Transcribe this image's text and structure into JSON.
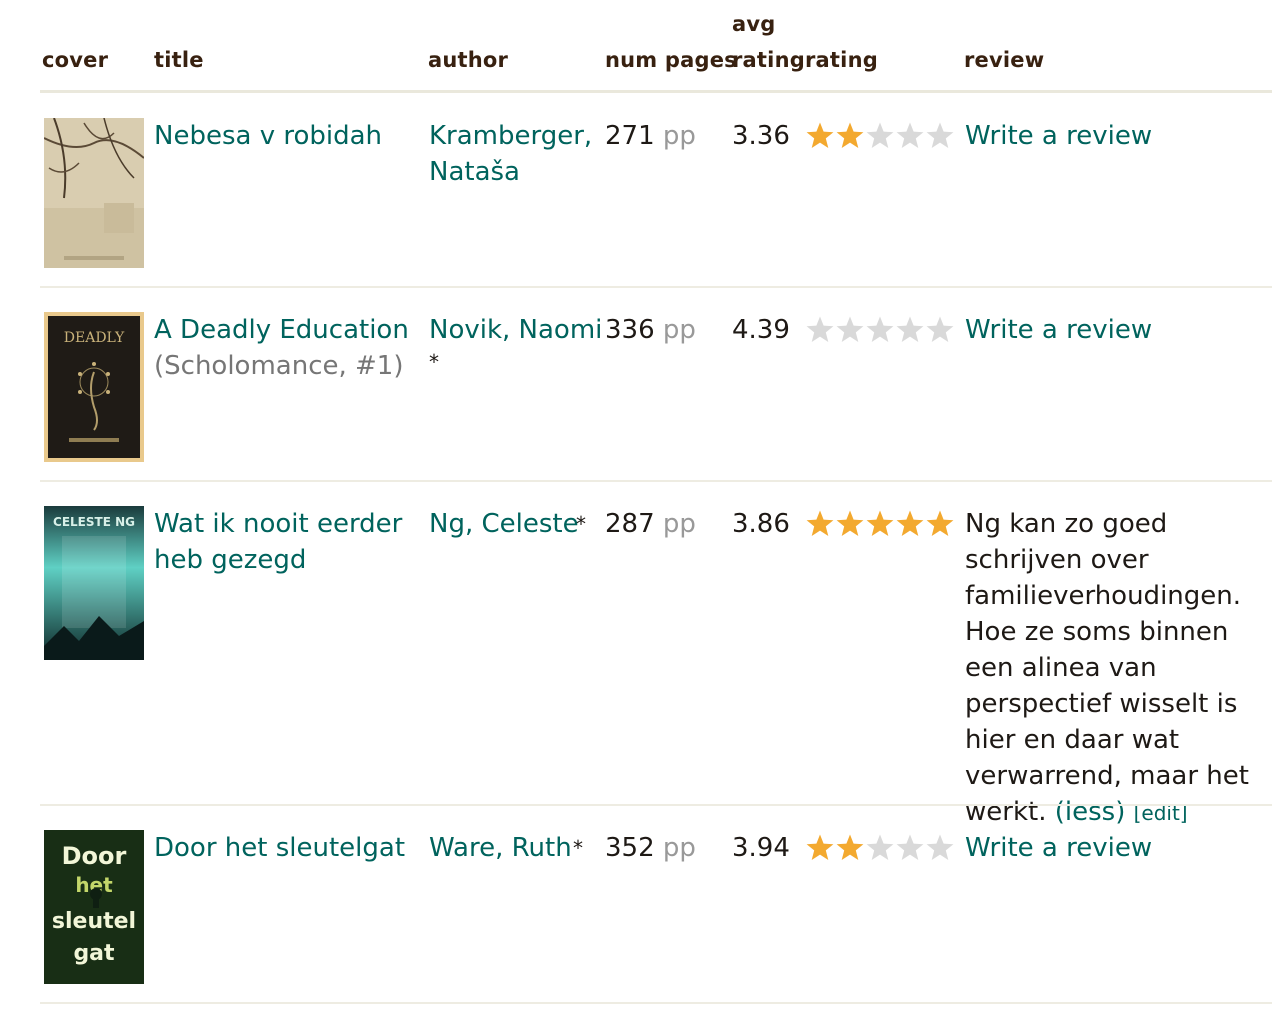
{
  "headers": {
    "cover": "cover",
    "title": "title",
    "author": "author",
    "num_pages": "num pages",
    "avg_rating_line1": "avg",
    "avg_rating_line2": "rating",
    "rating": "rating",
    "review": "review"
  },
  "colors": {
    "link": "#00635d",
    "header": "#382110",
    "star_filled": "#f3a92f",
    "star_empty": "#d9d9d9"
  },
  "rows": [
    {
      "title": "Nebesa v robidah",
      "series": "",
      "author_line1": "Kramberger,",
      "author_line2": "Nataša",
      "author_mark": "",
      "pages": "271",
      "pp": "pp",
      "avg_rating": "3.36",
      "my_rating": 2,
      "review_link": "Write a review"
    },
    {
      "title": "A Deadly Education",
      "series": "(Scholomance, #1)",
      "author_line1": "Novik, Naomi",
      "author_line2": "",
      "author_mark": "*",
      "pages": "336",
      "pp": "pp",
      "avg_rating": "4.39",
      "my_rating": 0,
      "review_link": "Write a review"
    },
    {
      "title": "Wat ik nooit eerder heb gezegd",
      "series": "",
      "author_line1": "Ng, Celeste",
      "author_line2": "",
      "author_mark": "*",
      "pages": "287",
      "pp": "pp",
      "avg_rating": "3.86",
      "my_rating": 5,
      "review_text": "Ng kan zo goed schrijven over familieverhoudingen. Hoe ze soms binnen een alinea van perspectief wisselt is hier en daar wat verwarrend, maar het werkt.",
      "less": "(less)",
      "edit": "[edit]"
    },
    {
      "title": "Door het sleutelgat",
      "series": "",
      "author_line1": "Ware, Ruth",
      "author_line2": "",
      "author_mark": "*",
      "pages": "352",
      "pp": "pp",
      "avg_rating": "3.94",
      "my_rating": 2,
      "review_link": "Write a review"
    }
  ],
  "covers": [
    {
      "icon": "cover-nebesa-icon",
      "text": ""
    },
    {
      "icon": "cover-deadly-icon",
      "text": "DEADLY"
    },
    {
      "icon": "cover-celeste-icon",
      "text": "CELESTE NG"
    },
    {
      "icon": "cover-sleutelgat-icon",
      "text": "Door het sleutel gat"
    }
  ]
}
